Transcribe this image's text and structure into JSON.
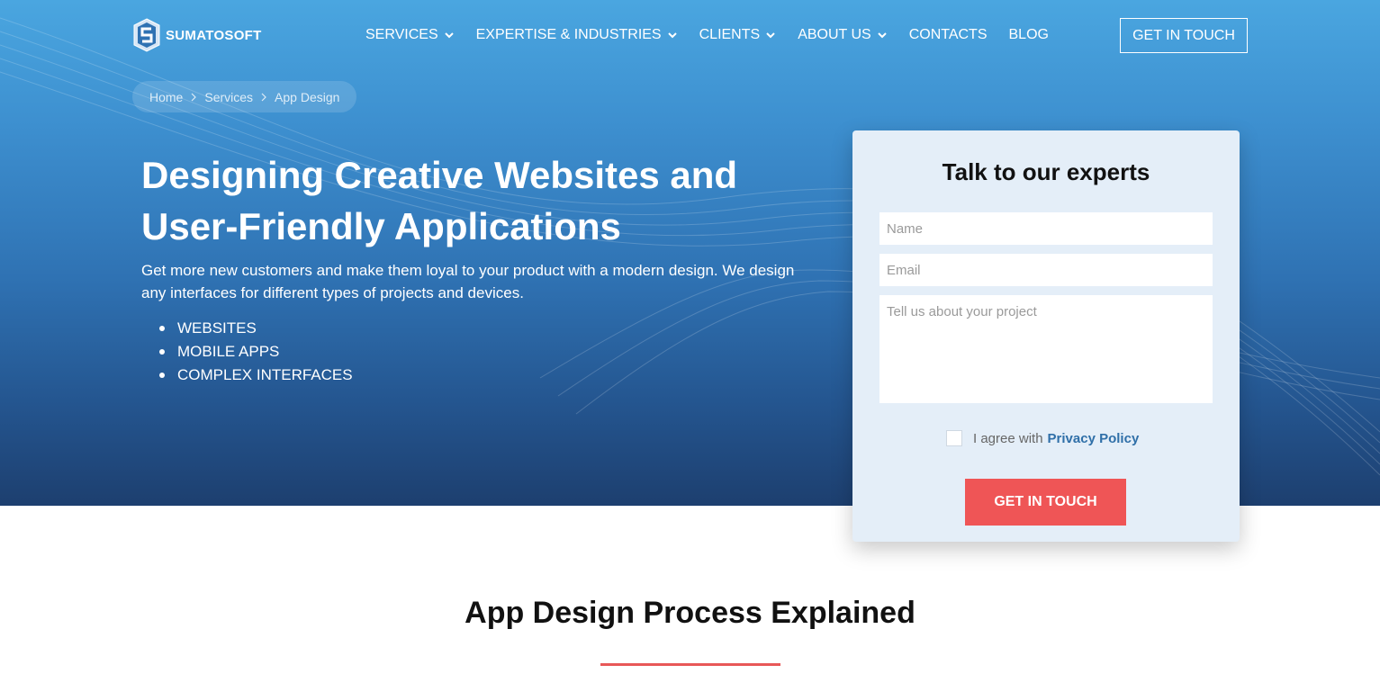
{
  "brand": {
    "name": "SUMATOSOFT",
    "logo_icon": "shield-s-logo-icon"
  },
  "nav": {
    "items": [
      {
        "label": "SERVICES",
        "has_dropdown": true
      },
      {
        "label": "EXPERTISE & INDUSTRIES",
        "has_dropdown": true
      },
      {
        "label": "CLIENTS",
        "has_dropdown": true
      },
      {
        "label": "ABOUT US",
        "has_dropdown": true
      },
      {
        "label": "CONTACTS",
        "has_dropdown": false
      },
      {
        "label": "BLOG",
        "has_dropdown": false
      }
    ],
    "cta_label": "GET IN TOUCH"
  },
  "breadcrumb": [
    "Home",
    "Services",
    "App Design"
  ],
  "hero": {
    "title_line1": "Designing Creative Websites and",
    "title_line2": "User-Friendly Applications",
    "description": "Get more new customers and make them loyal to your product with a modern design. We design any interfaces for different types of projects and devices.",
    "list": [
      "WEBSITES",
      "MOBILE APPS",
      "COMPLEX INTERFACES"
    ]
  },
  "form": {
    "title": "Talk to our experts",
    "name_placeholder": "Name",
    "email_placeholder": "Email",
    "project_placeholder": "Tell us about your project",
    "agree_text": "I agree with",
    "privacy_label": "Privacy Policy",
    "submit_label": "GET IN TOUCH"
  },
  "section": {
    "title": "App Design Process Explained"
  },
  "colors": {
    "hero_top": "#4aa6e0",
    "hero_bottom": "#1d3f6f",
    "accent_red": "#ef5556",
    "link_blue": "#2f6fa8",
    "card_bg": "#e4eef8"
  }
}
